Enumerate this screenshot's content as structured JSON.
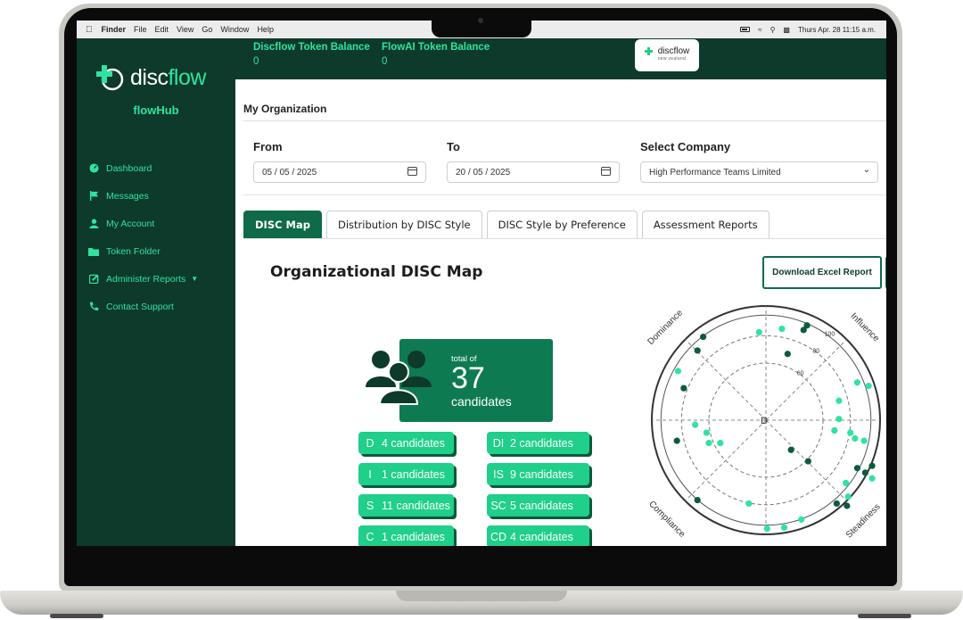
{
  "menubar": {
    "items": [
      "Finder",
      "File",
      "Edit",
      "View",
      "Go",
      "Window",
      "Help"
    ],
    "datetime": "Thurs Apr. 28 11:15 a.m."
  },
  "brand": {
    "logo_prefix": "disc",
    "logo_suffix": "flow",
    "hub": "flowHub",
    "badge_title": "discflow",
    "badge_sub": "new zealand"
  },
  "sidebar": {
    "items": [
      {
        "label": "Dashboard",
        "icon": "dashboard-icon"
      },
      {
        "label": "Messages",
        "icon": "flag-icon"
      },
      {
        "label": "My Account",
        "icon": "user-icon"
      },
      {
        "label": "Token Folder",
        "icon": "folder-icon"
      },
      {
        "label": "Administer Reports",
        "icon": "edit-icon"
      },
      {
        "label": "Contact Support",
        "icon": "phone-icon"
      }
    ]
  },
  "topbar": {
    "discflow_label": "Discflow Token Balance",
    "discflow_value": "0",
    "flowai_label": "FlowAI Token Balance",
    "flowai_value": "0"
  },
  "page": {
    "title": "My Organization",
    "from_label": "From",
    "from_value": "05 / 05 / 2025",
    "to_label": "To",
    "to_value": "20 / 05 / 2025",
    "company_label": "Select Company",
    "company_value": "High Performance Teams Limited"
  },
  "tabs": [
    "DISC Map",
    "Distribution by DISC Style",
    "DISC Style by Preference",
    "Assessment Reports"
  ],
  "panel": {
    "title": "Organizational DISC Map",
    "download_label": "Download Excel Report",
    "total_prefix": "total of",
    "total_value": "37",
    "total_suffix": "candidates"
  },
  "styles": [
    {
      "code": "D",
      "text": "4 candidates"
    },
    {
      "code": "DI",
      "text": "2 candidates"
    },
    {
      "code": "I",
      "text": "1 candidates"
    },
    {
      "code": "IS",
      "text": "9 candidates"
    },
    {
      "code": "S",
      "text": "11 candidates"
    },
    {
      "code": "SC",
      "text": "5 candidates"
    },
    {
      "code": "C",
      "text": "1 candidates"
    },
    {
      "code": "CD",
      "text": "4 candidates"
    }
  ],
  "colors": {
    "sidebar": "#0d3a2a",
    "accent": "#2fe3a0",
    "primary": "#0e6a49",
    "pill": "#1fcf8a",
    "dot_light": "#2fe3a0",
    "dot_dark": "#0d5a3c"
  },
  "chart_data": {
    "type": "scatter",
    "labels": {
      "top": "di",
      "left": "cd",
      "dominance": "Dominance",
      "influence": "Influence",
      "steadiness": "Steadiness",
      "compliance": "Compliance",
      "center": "D"
    },
    "rings": [
      "100",
      "80",
      "60"
    ],
    "points": [
      {
        "x": -0.55,
        "y": 0.73,
        "c": "dark"
      },
      {
        "x": -0.06,
        "y": 0.77,
        "c": "light"
      },
      {
        "x": 0.14,
        "y": 0.8,
        "c": "light"
      },
      {
        "x": 0.33,
        "y": 0.79,
        "c": "dark"
      },
      {
        "x": 0.36,
        "y": 0.83,
        "c": "dark"
      },
      {
        "x": -0.6,
        "y": 0.61,
        "c": "dark"
      },
      {
        "x": 0.19,
        "y": 0.58,
        "c": "dark"
      },
      {
        "x": -0.77,
        "y": 0.43,
        "c": "light"
      },
      {
        "x": -0.72,
        "y": 0.28,
        "c": "dark"
      },
      {
        "x": -0.62,
        "y": -0.04,
        "c": "light"
      },
      {
        "x": -0.52,
        "y": -0.11,
        "c": "light"
      },
      {
        "x": -0.5,
        "y": -0.2,
        "c": "light"
      },
      {
        "x": -0.4,
        "y": -0.2,
        "c": "light"
      },
      {
        "x": -0.78,
        "y": -0.18,
        "c": "dark"
      },
      {
        "x": 0.64,
        "y": 0.17,
        "c": "light"
      },
      {
        "x": 0.6,
        "y": -0.09,
        "c": "light"
      },
      {
        "x": 0.74,
        "y": -0.11,
        "c": "light"
      },
      {
        "x": 0.78,
        "y": -0.16,
        "c": "light"
      },
      {
        "x": 0.86,
        "y": -0.18,
        "c": "light"
      },
      {
        "x": 0.8,
        "y": 0.33,
        "c": "light"
      },
      {
        "x": 0.9,
        "y": 0.3,
        "c": "light"
      },
      {
        "x": 0.64,
        "y": 0.01,
        "c": "light"
      },
      {
        "x": 0.22,
        "y": -0.26,
        "c": "dark"
      },
      {
        "x": 0.37,
        "y": -0.36,
        "c": "dark"
      },
      {
        "x": 0.8,
        "y": -0.42,
        "c": "dark"
      },
      {
        "x": 0.87,
        "y": -0.46,
        "c": "dark"
      },
      {
        "x": 0.93,
        "y": -0.4,
        "c": "dark"
      },
      {
        "x": 0.93,
        "y": -0.51,
        "c": "light"
      },
      {
        "x": 0.7,
        "y": -0.55,
        "c": "light"
      },
      {
        "x": 0.62,
        "y": -0.73,
        "c": "dark"
      },
      {
        "x": 0.71,
        "y": -0.75,
        "c": "dark"
      },
      {
        "x": 0.72,
        "y": -0.67,
        "c": "light"
      },
      {
        "x": -0.6,
        "y": -0.7,
        "c": "dark"
      },
      {
        "x": -0.15,
        "y": -0.73,
        "c": "light"
      },
      {
        "x": 0.31,
        "y": -0.87,
        "c": "light"
      },
      {
        "x": 0.01,
        "y": -0.95,
        "c": "light"
      },
      {
        "x": 0.16,
        "y": -0.94,
        "c": "light"
      }
    ]
  }
}
